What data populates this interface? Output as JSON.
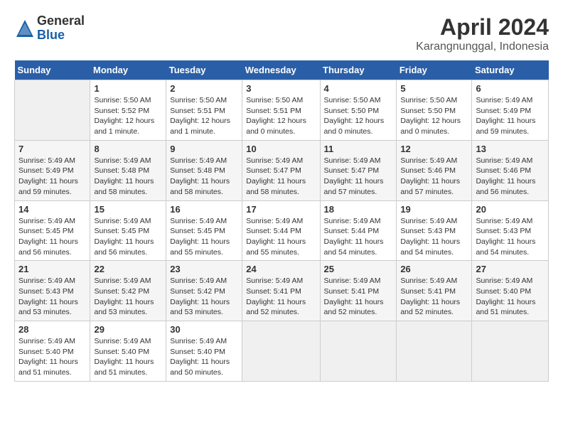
{
  "logo": {
    "general": "General",
    "blue": "Blue"
  },
  "title": "April 2024",
  "location": "Karangnunggal, Indonesia",
  "days_of_week": [
    "Sunday",
    "Monday",
    "Tuesday",
    "Wednesday",
    "Thursday",
    "Friday",
    "Saturday"
  ],
  "weeks": [
    [
      {
        "day": "",
        "info": ""
      },
      {
        "day": "1",
        "info": "Sunrise: 5:50 AM\nSunset: 5:52 PM\nDaylight: 12 hours\nand 1 minute."
      },
      {
        "day": "2",
        "info": "Sunrise: 5:50 AM\nSunset: 5:51 PM\nDaylight: 12 hours\nand 1 minute."
      },
      {
        "day": "3",
        "info": "Sunrise: 5:50 AM\nSunset: 5:51 PM\nDaylight: 12 hours\nand 0 minutes."
      },
      {
        "day": "4",
        "info": "Sunrise: 5:50 AM\nSunset: 5:50 PM\nDaylight: 12 hours\nand 0 minutes."
      },
      {
        "day": "5",
        "info": "Sunrise: 5:50 AM\nSunset: 5:50 PM\nDaylight: 12 hours\nand 0 minutes."
      },
      {
        "day": "6",
        "info": "Sunrise: 5:49 AM\nSunset: 5:49 PM\nDaylight: 11 hours\nand 59 minutes."
      }
    ],
    [
      {
        "day": "7",
        "info": "Sunrise: 5:49 AM\nSunset: 5:49 PM\nDaylight: 11 hours\nand 59 minutes."
      },
      {
        "day": "8",
        "info": "Sunrise: 5:49 AM\nSunset: 5:48 PM\nDaylight: 11 hours\nand 58 minutes."
      },
      {
        "day": "9",
        "info": "Sunrise: 5:49 AM\nSunset: 5:48 PM\nDaylight: 11 hours\nand 58 minutes."
      },
      {
        "day": "10",
        "info": "Sunrise: 5:49 AM\nSunset: 5:47 PM\nDaylight: 11 hours\nand 58 minutes."
      },
      {
        "day": "11",
        "info": "Sunrise: 5:49 AM\nSunset: 5:47 PM\nDaylight: 11 hours\nand 57 minutes."
      },
      {
        "day": "12",
        "info": "Sunrise: 5:49 AM\nSunset: 5:46 PM\nDaylight: 11 hours\nand 57 minutes."
      },
      {
        "day": "13",
        "info": "Sunrise: 5:49 AM\nSunset: 5:46 PM\nDaylight: 11 hours\nand 56 minutes."
      }
    ],
    [
      {
        "day": "14",
        "info": "Sunrise: 5:49 AM\nSunset: 5:45 PM\nDaylight: 11 hours\nand 56 minutes."
      },
      {
        "day": "15",
        "info": "Sunrise: 5:49 AM\nSunset: 5:45 PM\nDaylight: 11 hours\nand 56 minutes."
      },
      {
        "day": "16",
        "info": "Sunrise: 5:49 AM\nSunset: 5:45 PM\nDaylight: 11 hours\nand 55 minutes."
      },
      {
        "day": "17",
        "info": "Sunrise: 5:49 AM\nSunset: 5:44 PM\nDaylight: 11 hours\nand 55 minutes."
      },
      {
        "day": "18",
        "info": "Sunrise: 5:49 AM\nSunset: 5:44 PM\nDaylight: 11 hours\nand 54 minutes."
      },
      {
        "day": "19",
        "info": "Sunrise: 5:49 AM\nSunset: 5:43 PM\nDaylight: 11 hours\nand 54 minutes."
      },
      {
        "day": "20",
        "info": "Sunrise: 5:49 AM\nSunset: 5:43 PM\nDaylight: 11 hours\nand 54 minutes."
      }
    ],
    [
      {
        "day": "21",
        "info": "Sunrise: 5:49 AM\nSunset: 5:43 PM\nDaylight: 11 hours\nand 53 minutes."
      },
      {
        "day": "22",
        "info": "Sunrise: 5:49 AM\nSunset: 5:42 PM\nDaylight: 11 hours\nand 53 minutes."
      },
      {
        "day": "23",
        "info": "Sunrise: 5:49 AM\nSunset: 5:42 PM\nDaylight: 11 hours\nand 53 minutes."
      },
      {
        "day": "24",
        "info": "Sunrise: 5:49 AM\nSunset: 5:41 PM\nDaylight: 11 hours\nand 52 minutes."
      },
      {
        "day": "25",
        "info": "Sunrise: 5:49 AM\nSunset: 5:41 PM\nDaylight: 11 hours\nand 52 minutes."
      },
      {
        "day": "26",
        "info": "Sunrise: 5:49 AM\nSunset: 5:41 PM\nDaylight: 11 hours\nand 52 minutes."
      },
      {
        "day": "27",
        "info": "Sunrise: 5:49 AM\nSunset: 5:40 PM\nDaylight: 11 hours\nand 51 minutes."
      }
    ],
    [
      {
        "day": "28",
        "info": "Sunrise: 5:49 AM\nSunset: 5:40 PM\nDaylight: 11 hours\nand 51 minutes."
      },
      {
        "day": "29",
        "info": "Sunrise: 5:49 AM\nSunset: 5:40 PM\nDaylight: 11 hours\nand 51 minutes."
      },
      {
        "day": "30",
        "info": "Sunrise: 5:49 AM\nSunset: 5:40 PM\nDaylight: 11 hours\nand 50 minutes."
      },
      {
        "day": "",
        "info": ""
      },
      {
        "day": "",
        "info": ""
      },
      {
        "day": "",
        "info": ""
      },
      {
        "day": "",
        "info": ""
      }
    ]
  ]
}
